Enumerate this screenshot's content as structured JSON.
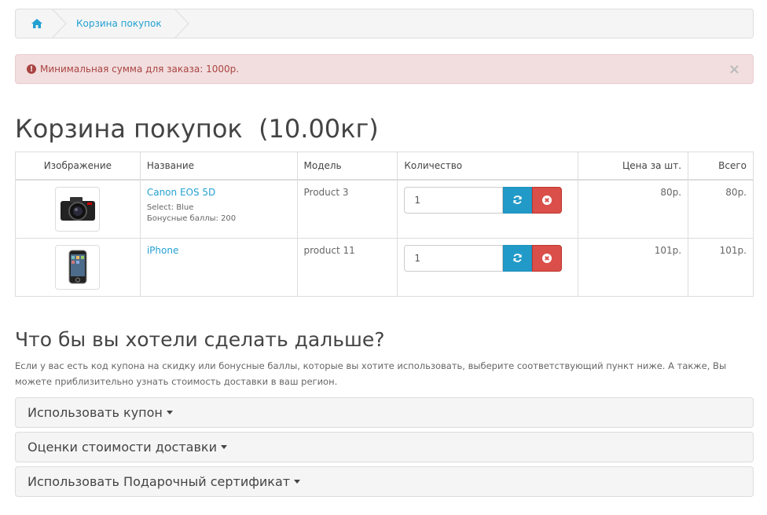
{
  "breadcrumb": {
    "home_icon": "home-icon",
    "current": "Корзина покупок"
  },
  "alert": {
    "text": "Минимальная сумма для заказа: 1000р.",
    "close": "×"
  },
  "page": {
    "title": "Корзина покупок  (10.00кг)"
  },
  "table": {
    "headers": {
      "image": "Изображение",
      "name": "Название",
      "model": "Модель",
      "quantity": "Количество",
      "unit_price": "Цена за шт.",
      "total": "Всего"
    },
    "rows": [
      {
        "name": "Canon EOS 5D",
        "option": "Select: Blue",
        "points": "Бонусные баллы: 200",
        "model": "Product 3",
        "quantity": "1",
        "unit_price": "80р.",
        "total": "80р."
      },
      {
        "name": "iPhone",
        "model": "product 11",
        "quantity": "1",
        "unit_price": "101р.",
        "total": "101р."
      }
    ]
  },
  "next": {
    "heading": "Что бы вы хотели сделать дальше?",
    "hint": "Если у вас есть код купона на скидку или бонусные баллы, которые вы хотите использовать, выберите соответствующий пункт ниже. А также, Вы можете приблизительно узнать стоимость доставки в ваш регион.",
    "panels": [
      "Использовать купон",
      "Оценки стоимости доставки",
      "Использовать Подарочный сертификат"
    ]
  },
  "colors": {
    "link": "#23a1d1",
    "alert_bg": "#f2dede",
    "alert_text": "#a94442",
    "update_btn": "#229ac8",
    "remove_btn": "#da4f49"
  }
}
